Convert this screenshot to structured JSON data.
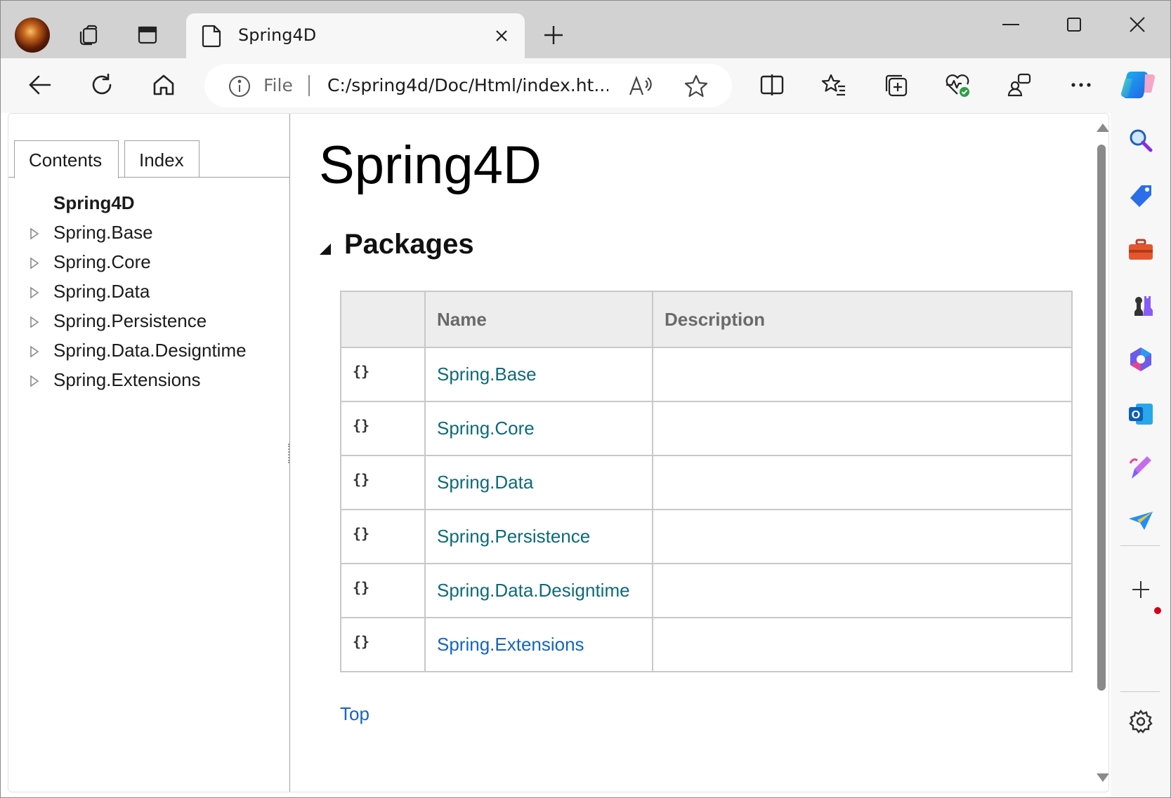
{
  "browser": {
    "tab": {
      "title": "Spring4D"
    },
    "address": {
      "scheme_label": "File",
      "url": "C:/spring4d/Doc/Html/index.ht..."
    },
    "icons": {
      "profile": "profile-avatar-icon",
      "workspaces": "workspaces-icon",
      "tab_actions": "vertical-tabs-icon",
      "new_tab": "plus-icon",
      "back": "back-arrow-icon",
      "refresh": "refresh-icon",
      "home": "home-icon",
      "info": "info-icon",
      "read_aloud": "read-aloud-icon",
      "favorite": "star-icon",
      "split_screen": "split-screen-icon",
      "favorites": "favorites-icon",
      "collections": "collections-icon",
      "browser_essentials": "heart-pulse-icon",
      "feedback": "feedback-icon",
      "more": "more-icon",
      "copilot": "copilot-icon"
    }
  },
  "toc": {
    "tabs": [
      {
        "label": "Contents",
        "active": true
      },
      {
        "label": "Index",
        "active": false
      }
    ],
    "items": [
      {
        "label": "Spring4D",
        "root": true
      },
      {
        "label": "Spring.Base",
        "root": false
      },
      {
        "label": "Spring.Core",
        "root": false
      },
      {
        "label": "Spring.Data",
        "root": false
      },
      {
        "label": "Spring.Persistence",
        "root": false
      },
      {
        "label": "Spring.Data.Designtime",
        "root": false
      },
      {
        "label": "Spring.Extensions",
        "root": false
      }
    ]
  },
  "doc": {
    "title": "Spring4D",
    "section_title": "Packages",
    "table": {
      "headers": [
        "",
        "Name",
        "Description"
      ],
      "rows": [
        {
          "icon": "{}",
          "name": "Spring.Base",
          "description": ""
        },
        {
          "icon": "{}",
          "name": "Spring.Core",
          "description": ""
        },
        {
          "icon": "{}",
          "name": "Spring.Data",
          "description": ""
        },
        {
          "icon": "{}",
          "name": "Spring.Persistence",
          "description": ""
        },
        {
          "icon": "{}",
          "name": "Spring.Data.Designtime",
          "description": ""
        },
        {
          "icon": "{}",
          "name": "Spring.Extensions",
          "description": ""
        }
      ]
    },
    "top_link": "Top"
  },
  "sidebar": {
    "items": [
      "search-icon",
      "shopping-tag-icon",
      "tools-icon",
      "games-icon",
      "microsoft-365-icon",
      "outlook-icon",
      "designer-icon",
      "drop-icon",
      "add-icon",
      "settings-icon"
    ]
  },
  "colors": {
    "link_teal": "#0d6b78",
    "link_blue": "#1565c0",
    "tab_strip": "#d2d2d2",
    "toolbar": "#f7f7f7"
  }
}
